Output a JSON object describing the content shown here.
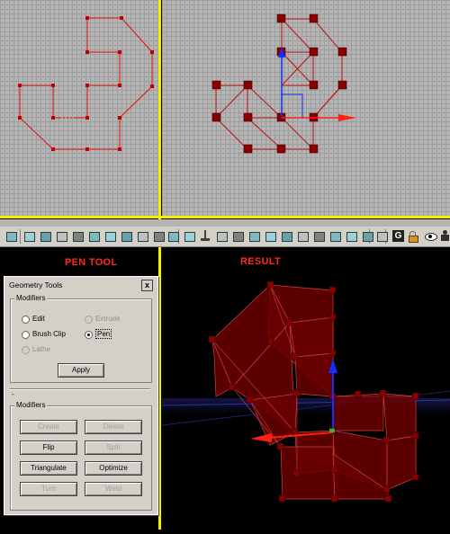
{
  "viewports": {
    "left_title": "",
    "right_title": ""
  },
  "headings": {
    "pen_tool": "PEN TOOL",
    "result": "RESULT"
  },
  "toolbar": {
    "icons": [
      "cube-icon",
      "cube-icon",
      "cube-icon",
      "cube-icon",
      "cube-icon",
      "cube-icon",
      "cube-icon",
      "cube-icon",
      "cube-icon",
      "cube-icon",
      "cube-icon",
      "cube-icon",
      "brush-icon",
      "cube-icon",
      "cube-icon",
      "cube-icon",
      "cube-icon",
      "cube-icon",
      "cube-icon",
      "cube-icon",
      "cube-icon",
      "cube-icon",
      "cube-icon",
      "cube-icon",
      "g-icon",
      "lock-icon",
      "eye-icon",
      "player-icon",
      "person-icon"
    ],
    "g_label": "G"
  },
  "dialog": {
    "title": "Geometry Tools",
    "close": "x",
    "modifiers_top": {
      "label": "Modifiers",
      "options": [
        {
          "label": "Edit",
          "selected": false,
          "enabled": true
        },
        {
          "label": "Extrude",
          "selected": false,
          "enabled": false
        },
        {
          "label": "Brush Clip",
          "selected": false,
          "enabled": true
        },
        {
          "label": "Pen",
          "selected": true,
          "enabled": true
        },
        {
          "label": "Lathe",
          "selected": false,
          "enabled": false
        }
      ],
      "apply": "Apply"
    },
    "section_dash": "-",
    "modifiers_bottom": {
      "label": "Modifiers",
      "buttons": [
        {
          "label": "Create",
          "enabled": false
        },
        {
          "label": "Delete",
          "enabled": false
        },
        {
          "label": "Flip",
          "enabled": true
        },
        {
          "label": "Split",
          "enabled": false
        },
        {
          "label": "Triangulate",
          "enabled": true
        },
        {
          "label": "Optimize",
          "enabled": true
        },
        {
          "label": "Turn",
          "enabled": false
        },
        {
          "label": "Weld",
          "enabled": false
        }
      ]
    }
  },
  "colors": {
    "grid_bg": "#b4b4b4",
    "separator": "#f0f000",
    "heading": "#ff2a1a",
    "vertex": "#8a0000",
    "edge": "#e01010",
    "mesh_fill": "#7a0000",
    "gizmo_blue": "#1030ff",
    "gizmo_red": "#ff2010"
  }
}
